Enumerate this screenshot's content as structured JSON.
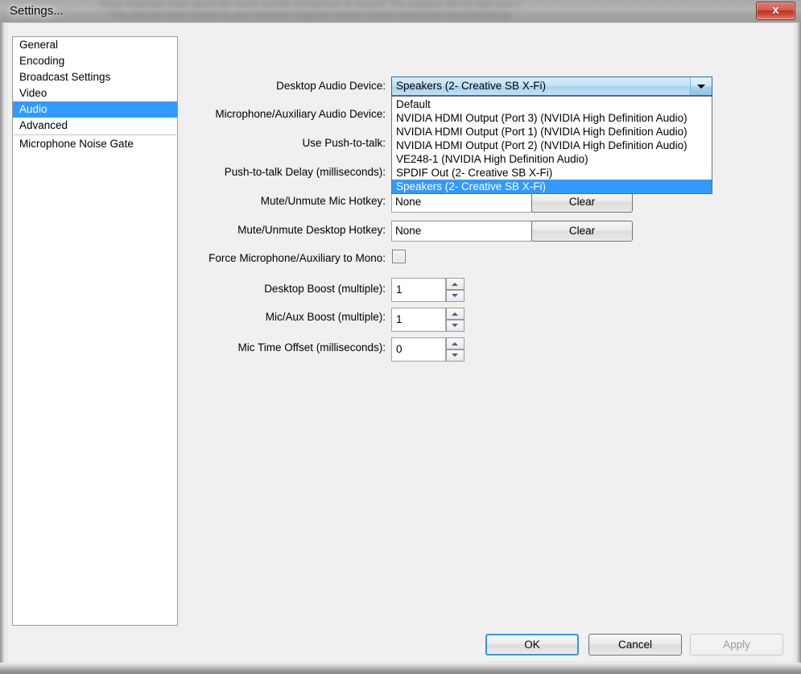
{
  "window": {
    "title": "Settings...",
    "close_label": "x",
    "glass_blur_line1": "Some important notes about the sound and the microphone at second. The program will not take your c",
    "glass_blur_line2": "...  This way the Wave Output on your Windows Playback Volume Control determines how loud the ga"
  },
  "sidebar": {
    "items": [
      {
        "label": "General",
        "selected": false,
        "separator_after": false
      },
      {
        "label": "Encoding",
        "selected": false,
        "separator_after": false
      },
      {
        "label": "Broadcast Settings",
        "selected": false,
        "separator_after": false
      },
      {
        "label": "Video",
        "selected": false,
        "separator_after": false
      },
      {
        "label": "Audio",
        "selected": true,
        "separator_after": false
      },
      {
        "label": "Advanced",
        "selected": false,
        "separator_after": true
      },
      {
        "label": "Microphone Noise Gate",
        "selected": false,
        "separator_after": false
      }
    ]
  },
  "form": {
    "labels": {
      "desktop_audio_device": "Desktop Audio Device:",
      "mic_aux_device": "Microphone/Auxiliary Audio Device:",
      "use_push_to_talk": "Use Push-to-talk:",
      "push_to_talk_delay": "Push-to-talk Delay (milliseconds):",
      "mute_mic_hotkey": "Mute/Unmute Mic Hotkey:",
      "mute_desktop_hotkey": "Mute/Unmute Desktop Hotkey:",
      "force_mono": "Force Microphone/Auxiliary to Mono:",
      "desktop_boost": "Desktop Boost (multiple):",
      "mic_aux_boost": "Mic/Aux Boost (multiple):",
      "mic_time_offset": "Mic Time Offset (milliseconds):"
    },
    "desktop_audio_device": {
      "selected": "Speakers (2- Creative SB X-Fi)",
      "expanded": true,
      "options": [
        "Default",
        "NVIDIA HDMI Output (Port 3) (NVIDIA High Definition Audio)",
        "NVIDIA HDMI Output (Port 1) (NVIDIA High Definition Audio)",
        "NVIDIA HDMI Output (Port 2) (NVIDIA High Definition Audio)",
        "VE248-1 (NVIDIA High Definition Audio)",
        "SPDIF Out (2- Creative SB X-Fi)",
        "Speakers (2- Creative SB X-Fi)"
      ],
      "selected_index": 6
    },
    "mute_mic_hotkey": {
      "value": "None",
      "clear_label": "Clear"
    },
    "mute_desktop_hotkey": {
      "value": "None",
      "clear_label": "Clear"
    },
    "force_mono": {
      "checked": false
    },
    "desktop_boost": {
      "value": "1"
    },
    "mic_aux_boost": {
      "value": "1"
    },
    "mic_time_offset": {
      "value": "0"
    }
  },
  "footer": {
    "ok": "OK",
    "cancel": "Cancel",
    "apply": "Apply",
    "apply_disabled": true
  },
  "colors": {
    "selection_blue": "#3399ff",
    "window_bg": "#f0f0f0",
    "default_button_outline": "#2e9bd6",
    "close_button_red": "#cf4f3b"
  }
}
